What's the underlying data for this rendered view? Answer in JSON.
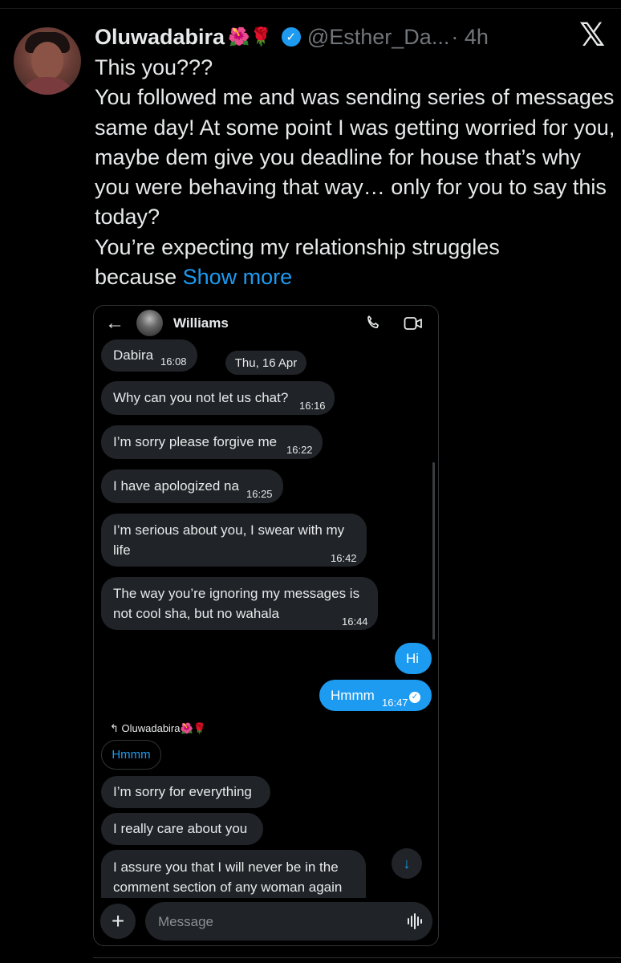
{
  "tweet": {
    "display_name": "Oluwadabira",
    "name_emojis": "🌺🌹",
    "handle": "@Esther_Da...",
    "time": "· 4h",
    "paragraphs": [
      "This you???",
      "You followed me and was sending series of messages same day! At some point I was getting worried for you, maybe dem give you deadline for house that’s why you were behaving that way… only for you to say this today?",
      "You’re expecting my relationship struggles"
    ],
    "last_line_start": "because",
    "show_more": "Show more",
    "x_logo": "𝕏"
  },
  "chat": {
    "contact_name": "Williams",
    "date_pill": "Thu, 16 Apr",
    "messages": [
      {
        "text": "Dabira",
        "time": "16:08"
      },
      {
        "text": "Why can you not let us chat?",
        "time": "16:16"
      },
      {
        "text": "I’m sorry please forgive me",
        "time": "16:22"
      },
      {
        "text": "I have apologized na",
        "time": "16:25"
      },
      {
        "text": "I’m serious about you, I swear with my life",
        "time": "16:42"
      },
      {
        "text": "The way you’re ignoring my messages is not cool sha, but no wahala",
        "time": "16:44"
      },
      {
        "text": "Hi",
        "time": ""
      },
      {
        "text": "Hmmm",
        "time": "16:47"
      },
      {
        "text": "I’m sorry for everything",
        "time": ""
      },
      {
        "text": "I really care about you",
        "time": ""
      },
      {
        "text": "I assure you that I will never be in the comment section of any woman again",
        "time": ""
      }
    ],
    "reply_to_name": "↰ Oluwadabira🌺🌹",
    "quoted_text": "Hmmm",
    "composer_placeholder": "Message",
    "plus_label": "+"
  },
  "colors": {
    "accent": "#1d9bf0",
    "bubble": "#202327",
    "background": "#000000"
  },
  "icons": [
    "back-arrow-icon",
    "phone-icon",
    "video-icon",
    "verified-badge-icon",
    "x-logo-icon",
    "scroll-down-icon",
    "waveform-icon",
    "plus-icon"
  ]
}
